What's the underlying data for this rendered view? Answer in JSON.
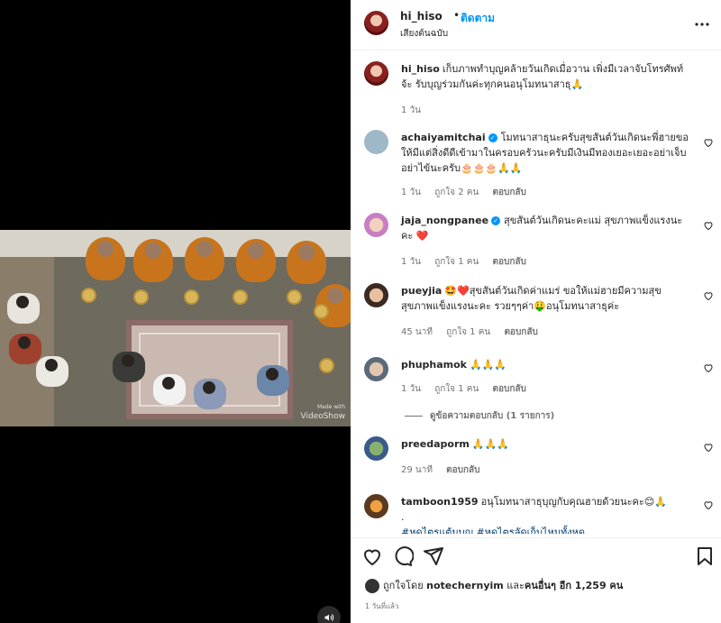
{
  "header": {
    "username": "hi_hiso",
    "separator": "•",
    "follow_label": "ติดตาม",
    "audio_label": "เสียงต้นฉบับ",
    "more_icon": "more-horizontal-icon"
  },
  "video": {
    "watermark_small": "Made with",
    "watermark": "VideoShow",
    "volume_icon": "volume-icon"
  },
  "caption": {
    "username": "hi_hiso",
    "text": "เก็บภาพทำบุญคล้ายวันเกิดเมื่อวาน เพิ่งมีเวลาจับโทรศัพท์จ้ะ รับบุญร่วมกันค่ะทุกคนอนุโมทนาสาธุ🙏",
    "time": "1 วัน"
  },
  "comments": [
    {
      "username": "achaiyamitchai",
      "verified": true,
      "text": "โมทนาสาธุนะครับสุขสันต์วันเกิดนะพี่ฮายขอให้มีแต่สิ่งดีดีเข้ามาในครอบครัวนะครับมีเงินมีทองเยอะเยอะอย่าเจ็บอย่าไข้นะครับ🎂🎂🎂🙏🙏",
      "time": "1 วัน",
      "likes": "ถูกใจ 2 คน",
      "reply": "ตอบกลับ"
    },
    {
      "username": "jaja_nongpanee",
      "verified": true,
      "text": "สุขสันต์วันเกิดนะคะแม่ สุขภาพแข็งแรงนะคะ ❤️",
      "time": "1 วัน",
      "likes": "ถูกใจ 1 คน",
      "reply": "ตอบกลับ"
    },
    {
      "username": "pueyjia",
      "verified": false,
      "text": "🤩❤️สุขสันต์วันเกิดค่าแมร่ ขอให้แม่ฮายมีความสุขสุขภาพแข็งแรงนะคะ รวยๆๆค่า🤑อนุโมทนาสาธุค่ะ",
      "time": "45 นาที",
      "likes": "ถูกใจ 1 คน",
      "reply": "ตอบกลับ"
    },
    {
      "username": "phuphamok",
      "verified": false,
      "text": "🙏🙏🙏",
      "time": "1 วัน",
      "likes": "ถูกใจ 1 คน",
      "reply": "ตอบกลับ",
      "view_replies": "ดูข้อความตอบกลับ (1 รายการ)"
    },
    {
      "username": "preedaporm",
      "verified": false,
      "text": "🙏🙏🙏",
      "time": "29 นาที",
      "reply": "ตอบกลับ"
    },
    {
      "username": "tamboon1959",
      "verified": false,
      "text": "อนุโมทนาสาธุบุญกับคุณฮายด้วยนะคะ😊🙏",
      "extra": ".",
      "tags": "#หดไตรแต้มบุญ #หดไตรลัดเก็บไหมทั้งหด"
    }
  ],
  "actions": {
    "like_icon": "heart-icon",
    "comment_icon": "comment-icon",
    "share_icon": "share-icon",
    "save_icon": "bookmark-icon"
  },
  "likes": {
    "prefix": "ถูกใจโดย",
    "user": "notechernyim",
    "middle": "และ",
    "others": "คนอื่นๆ อีก 1,259 คน"
  },
  "date": "1 วันที่แล้ว",
  "colors": {
    "link": "#0095f6",
    "muted": "#737373",
    "text": "#262626",
    "heart_red": "#ed4956"
  }
}
